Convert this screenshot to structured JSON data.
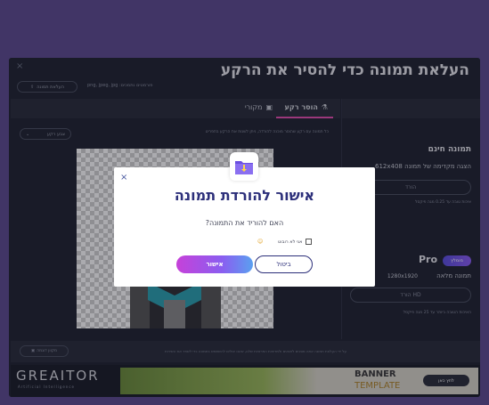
{
  "app": {
    "close_icon": "×",
    "title": "העלאת תמונה כדי להסיר את הרקע",
    "upload_button": "העלאת תמונה",
    "supported_formats": "פורמטים נתמכים: png, jpeg, jpg"
  },
  "tabs": {
    "remove_bg": "הוסר רקע",
    "original": "מקורי"
  },
  "editor": {
    "info_text": "כל תמונה עם רקע שהוסר מוכנה להורדה, ניתן לשנות את הרקע בתפריט",
    "bg_select": "צבע רקע"
  },
  "right_panel": {
    "free_title": "תמונה חינם",
    "free_sub": "הצגה מקדימה של תמונה 612x408",
    "free_button": "הורד",
    "free_note": "איכות טובה עד 0.25 מגה פיקסל",
    "pro_label": "Pro",
    "pro_badge": "מומלץ",
    "pro_sub1": "תמונה מלאה",
    "pro_sub2": "1280x1920",
    "pro_button": "הורד HD",
    "pro_note": "האיכות הטובה ביותר עד 25 מגה פיקסל"
  },
  "footer": {
    "button": "מקוון דוגמה",
    "text": "על ידי העלאת תמונה אתה מסכים לתנאים ולמדיניות הפרטיות שלנו, שאנו יכולים להשתמש בתמונה כדי לשפר את השירות"
  },
  "ad": {
    "brand": "GREAITOR",
    "brand_sub": "Artificial Intelligence",
    "banner_line1": "BANNER",
    "banner_line2": "TEMPLATE",
    "banner_button": "לחץ כאן"
  },
  "modal": {
    "title": "אישור להורדת תמונה",
    "question": "האם להוריד את התמונה?",
    "checkbox_label": "אני לא רובוט",
    "emoji": "☺",
    "cancel": "ביטול",
    "confirm": "אישור",
    "close_icon": "×"
  },
  "colors": {
    "accent": "#e64fb0",
    "modal_title": "#2c2f7a"
  }
}
